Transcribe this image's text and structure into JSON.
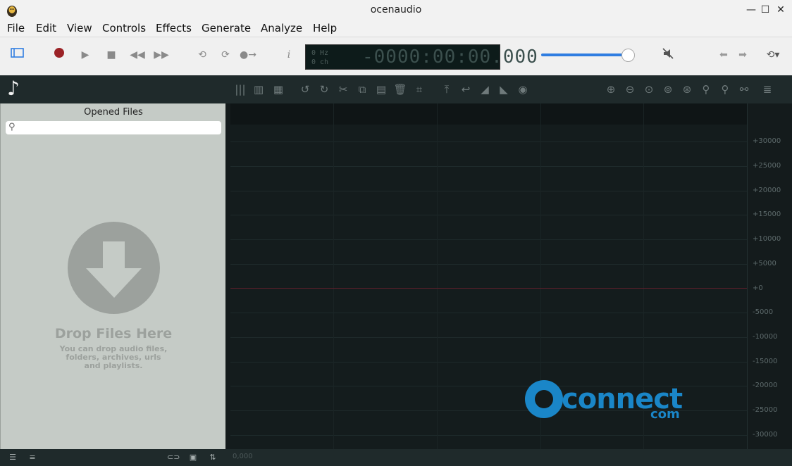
{
  "window": {
    "title": "ocenaudio"
  },
  "menu": [
    "File",
    "Edit",
    "View",
    "Controls",
    "Effects",
    "Generate",
    "Analyze",
    "Help"
  ],
  "display": {
    "hz": "0 Hz",
    "ch": "0 ch",
    "time": "-0000:00:00.000"
  },
  "volume": {
    "level": 0.95
  },
  "sidebar": {
    "title": "Opened Files",
    "search_placeholder": "",
    "drop_title": "Drop Files Here",
    "drop_desc": "You can drop audio files, folders, archives, urls and playlists."
  },
  "scale_ticks": [
    "+30000",
    "+25000",
    "+20000",
    "+15000",
    "+10000",
    "+5000",
    "+0",
    "-5000",
    "-10000",
    "-15000",
    "-20000",
    "-25000",
    "-30000"
  ],
  "status": {
    "time": "0,000"
  },
  "watermark": {
    "text": "connect",
    "suffix": "com"
  },
  "colors": {
    "accent": "#2f7de1",
    "record": "#9b2226",
    "editor_bg": "#141b1c",
    "watermark": "#1a86c8"
  }
}
